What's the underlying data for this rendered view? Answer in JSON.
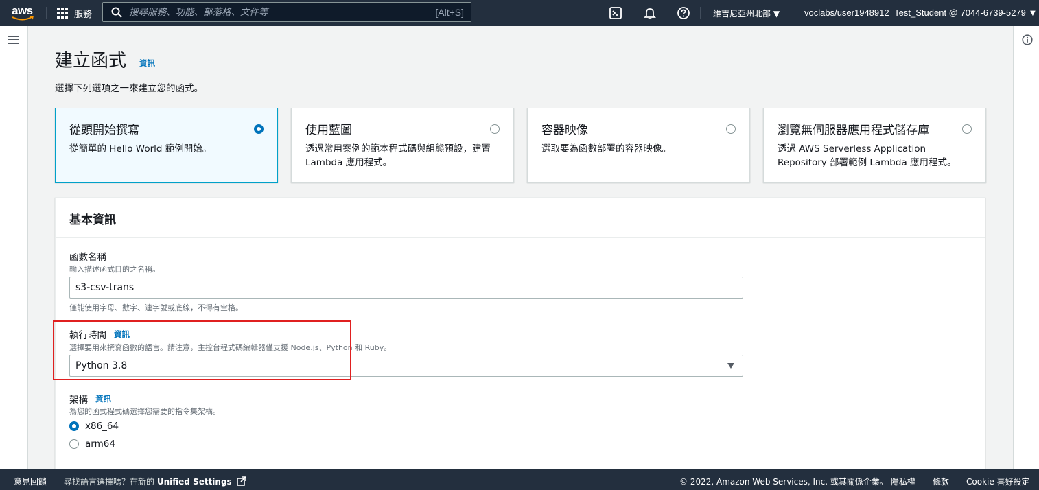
{
  "topnav": {
    "logo_text": "aws",
    "services_label": "服務",
    "search_placeholder": "搜尋服務、功能、部落格、文件等",
    "search_shortcut": "[Alt+S]",
    "region": "維吉尼亞州北部 ▼",
    "account": "voclabs/user1948912=Test_Student @ 7044-6739-5279 ▼",
    "icons": [
      "cloudshell-icon",
      "notifications-icon",
      "help-icon"
    ]
  },
  "page": {
    "title": "建立函式",
    "info_link": "資訊",
    "description": "選擇下列選項之一來建立您的函式。"
  },
  "options": [
    {
      "title": "從頭開始撰寫",
      "desc": "從簡單的 Hello World 範例開始。",
      "selected": true
    },
    {
      "title": "使用藍圖",
      "desc": "透過常用案例的範本程式碼與組態預設，建置 Lambda 應用程式。",
      "selected": false
    },
    {
      "title": "容器映像",
      "desc": "選取要為函數部署的容器映像。",
      "selected": false
    },
    {
      "title": "瀏覽無伺服器應用程式儲存庫",
      "desc": "透過 AWS Serverless Application Repository 部署範例 Lambda 應用程式。",
      "selected": false
    }
  ],
  "basic_info": {
    "title": "基本資訊",
    "function_name": {
      "label": "函數名稱",
      "desc": "輸入描述函式目的之名稱。",
      "value": "s3-csv-trans",
      "constraint": "僅能使用字母、數字、連字號或底線，不得有空格。"
    },
    "runtime": {
      "label": "執行時間",
      "info": "資訊",
      "desc": "選擇要用來撰寫函數的語言。請注意，主控台程式碼編輯器僅支援 Node.js、Python 和 Ruby。",
      "value": "Python 3.8"
    },
    "architecture": {
      "label": "架構",
      "info": "資訊",
      "desc": "為您的函式程式碼選擇您需要的指令集架構。",
      "options": [
        {
          "label": "x86_64",
          "selected": true
        },
        {
          "label": "arm64",
          "selected": false
        }
      ]
    }
  },
  "footer": {
    "feedback": "意見回饋",
    "lang_prefix": "尋找語言選擇嗎？在新的",
    "lang_link": "Unified Settings",
    "copyright": "© 2022, Amazon Web Services, Inc. 或其關係企業。",
    "privacy": "隱私權",
    "terms": "條款",
    "cookie": "Cookie 喜好設定"
  },
  "colors": {
    "nav_bg": "#232f3e",
    "link": "#0073bb",
    "selected_border": "#00a1c9",
    "highlight_box": "#e02020"
  }
}
